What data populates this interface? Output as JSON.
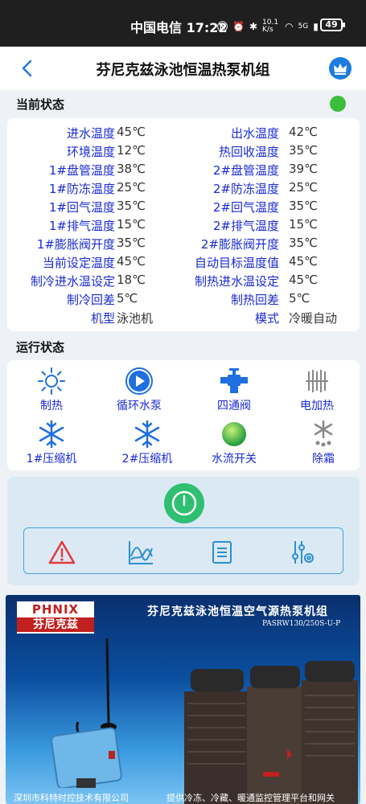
{
  "statusbar": {
    "carrier_time": "中国电信 17:22",
    "net_speed": "10.1 K/s",
    "signal": "5G",
    "battery": "49"
  },
  "header": {
    "title": "芬尼克兹泳池恒温热泵机组"
  },
  "current_state": {
    "title": "当前状态",
    "rows": [
      {
        "l_label": "进水温度",
        "l_val": "45℃",
        "r_label": "出水温度",
        "r_val": "42℃"
      },
      {
        "l_label": "环境温度",
        "l_val": "12℃",
        "r_label": "热回收温度",
        "r_val": "35℃"
      },
      {
        "l_label": "1#盘管温度",
        "l_val": "38℃",
        "r_label": "2#盘管温度",
        "r_val": "39℃"
      },
      {
        "l_label": "1#防冻温度",
        "l_val": "25℃",
        "r_label": "2#防冻温度",
        "r_val": "25℃"
      },
      {
        "l_label": "1#回气温度",
        "l_val": "35℃",
        "r_label": "2#回气温度",
        "r_val": "35℃"
      },
      {
        "l_label": "1#排气温度",
        "l_val": "15℃",
        "r_label": "2#排气温度",
        "r_val": "15℃"
      },
      {
        "l_label": "1#膨胀阀开度",
        "l_val": "35℃",
        "r_label": "2#膨胀阀开度",
        "r_val": "35℃"
      },
      {
        "l_label": "当前设定温度",
        "l_val": "45℃",
        "r_label": "自动目标温度值",
        "r_val": "45℃"
      },
      {
        "l_label": "制冷进水温设定",
        "l_val": "18℃",
        "r_label": "制热进水温设定",
        "r_val": "45℃"
      },
      {
        "l_label": "制冷回差",
        "l_val": "5℃",
        "r_label": "制热回差",
        "r_val": "5℃"
      },
      {
        "l_label": "机型",
        "l_val": "泳池机",
        "r_label": "模式",
        "r_val": "冷暖自动"
      }
    ]
  },
  "run_state": {
    "title": "运行状态",
    "items": [
      {
        "label": "制热",
        "icon": "sun-icon"
      },
      {
        "label": "循环水泵",
        "icon": "pump-play-icon"
      },
      {
        "label": "四通阀",
        "icon": "valve-icon"
      },
      {
        "label": "电加热",
        "icon": "heater-icon"
      },
      {
        "label": "1#压缩机",
        "icon": "snowflake-icon"
      },
      {
        "label": "2#压缩机",
        "icon": "snowflake-icon"
      },
      {
        "label": "水流开关",
        "icon": "water-flow-ball-icon"
      },
      {
        "label": "除霜",
        "icon": "defrost-icon"
      }
    ]
  },
  "banner": {
    "logo_en": "PHNIX",
    "logo_cn": "芬尼克兹",
    "title": "芬尼克兹泳池恒温空气源热泵机组",
    "model": "PASRW130/250S-U-P",
    "footer_left": "深圳市科特时控技术有限公司",
    "footer_right": "提供冷冻、冷藏、暖通监控管理平台和网关"
  },
  "colors": {
    "label_blue": "#1a2bd6",
    "accent": "#1e7be0",
    "status_green": "#3bbf3b",
    "power_green": "#2fbf71",
    "alarm_red": "#e23b3b"
  }
}
